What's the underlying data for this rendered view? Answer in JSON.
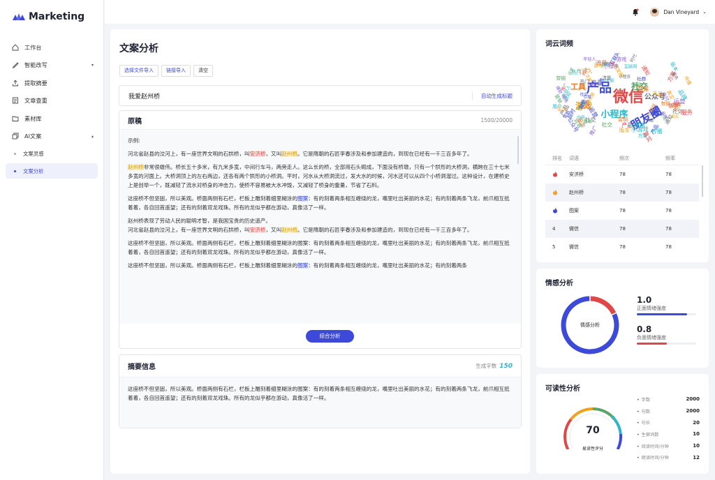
{
  "app": {
    "name": "Marketing"
  },
  "sidebar": {
    "items": [
      {
        "label": "工作台",
        "icon": "home-icon"
      },
      {
        "label": "智能改写",
        "icon": "pen-icon"
      },
      {
        "label": "提取摘要",
        "icon": "upload-icon"
      },
      {
        "label": "文章查重",
        "icon": "document-icon"
      },
      {
        "label": "素材库",
        "icon": "folder-icon"
      },
      {
        "label": "AI文案",
        "icon": "copy-icon"
      }
    ],
    "sub_items": [
      {
        "label": "文案灵感"
      },
      {
        "label": "文案分析",
        "active": true
      }
    ]
  },
  "header": {
    "user_name": "Dan Vineyard"
  },
  "main": {
    "title": "文案分析",
    "buttons": {
      "select_file": "选择文件导入",
      "link_import": "链接导入",
      "clear": "清空"
    },
    "article_title": "我爱赵州桥",
    "auto_title": "自动生成标题",
    "original": {
      "label": "原稿",
      "count": "1500/20000",
      "example_label": "示例:",
      "para1": {
        "a": "河北省赵县的洨河上，有一座世界文明的石拱桥，叫",
        "h1": "安济桥",
        "b": "，又叫",
        "h2": "赵州桥",
        "c": "。它是隋朝的石匠李春涉及和参加建造的，到现在已经有一千三百多年了。"
      },
      "para2": {
        "h": "赵州桥",
        "a": "非常很雄伟。桥长五十多米，有九米多宽，中间行车马，两旁走人。这么长的桥，全部用石头砌成，下面没有桥墩，只有一个拱形的大桥洞，横跨在三十七米多宽的河面上。大桥洞顶上的左右两边，还各有两个拱形的小桥洞。平时，河水从大桥洞流过，发大水的时候，河水还可以从四个小桥洞溜过。这种设计，在建桥史上是创举一个，既减轻了流水对桥身的冲击力，使桥不容易被大水冲毁，又减轻了桥身的重量，节省了石料。"
      },
      "para3": {
        "a": "这座桥不但坚固，所以美观。桥面两侧有石栏，栏板上雕刻着细里糊涂的",
        "h": "图案",
        "b": "：有的刻着两条相互缠绕的龙，嘴里吐出美丽的水花；有的刻着两条飞龙，前爪相互抵着着，各自回首遥望；还有的刻着双龙戏珠。所有的龙似乎都在游动，真像活了一样。"
      },
      "para4": {
        "line1": "赵州桥表现了劳动人民的聪明才智，是我国宝贵的历史遗产。",
        "a": "河北省赵县的洨河上，有一座世界文明的石拱桥，叫",
        "h1": "安济桥",
        "b": "，又叫",
        "h2": "赵州桥",
        "c": "。它是隋朝的石匠李春涉及和参加建造的，到现在已经有一千三百多年了。"
      },
      "para5": "这座桥不但坚固，所以美观。桥面两侧有石栏，栏板上雕刻着细里糊涂的图案：有的刻着两条相互缠绕的龙，嘴里吐出美丽的水花；有的刻着两条飞龙，前爪相互抵着着，各自回首遥望；还有的刻着双龙戏珠。所有的龙似乎都在游动，真像活了一样。",
      "para6": {
        "a": "这座桥不但坚固，所以美观。桥面两侧有石栏，栏板上雕刻着细里糊涂的",
        "h": "图案",
        "b": "：有的刻着两条相互缠绕的龙，嘴里吐出美丽的水花；有的刻着两条"
      },
      "analyze_button": "综合分析"
    },
    "summary": {
      "label": "摘要信息",
      "count_label": "生成字数",
      "count": "150",
      "text": "这座桥不但坚固，所以美观。桥面两侧有石栏，栏板上雕刻着细里糊涂的图案：有的刻着两条相互缠绕的龙，嘴里吐出美丽的水花；有的刻着两条飞龙，前爪相互抵着着，各自回首遥望；还有的刻着双龙戏珠。所有的龙似乎都在游动，真像活了一样。"
    }
  },
  "word_cloud": {
    "title": "词云词频",
    "words": [
      "产品",
      "微信",
      "朋友圈",
      "小程序",
      "游戏",
      "社交",
      "工具",
      "公众号",
      "原动力",
      "设计",
      "小游戏",
      "时代",
      "红利",
      "用户",
      "营销",
      "流量",
      "案例",
      "裂变",
      "创意",
      "真实",
      "版本",
      "互联网",
      "爆款",
      "引导",
      "数据",
      "传播",
      "超时",
      "生活",
      "服务",
      "方案",
      "内容",
      "社群",
      "年轻",
      "品牌",
      "运营",
      "支付",
      "手机",
      "直播",
      "在用",
      "年轻人",
      "热门",
      "推广",
      "新品",
      "通知"
    ],
    "colors": [
      "#3d49d8",
      "#e04848",
      "#f0a21f",
      "#2fb5c9",
      "#5aa469",
      "#8a63d2",
      "#e07a2f",
      "#6d6f7a"
    ],
    "columns": [
      "排名",
      "词语",
      "频次",
      "频率"
    ],
    "rows": [
      {
        "rank": "",
        "rank_icon": "flame-red-icon",
        "word": "安济桥",
        "freq": "78",
        "rate": "78"
      },
      {
        "rank": "",
        "rank_icon": "flame-orange-icon",
        "word": "赵州桥",
        "freq": "78",
        "rate": "78"
      },
      {
        "rank": "",
        "rank_icon": "flame-blue-icon",
        "word": "图案",
        "freq": "78",
        "rate": "78"
      },
      {
        "rank": "4",
        "word": "微信",
        "freq": "78",
        "rate": "78"
      },
      {
        "rank": "5",
        "word": "微信",
        "freq": "78",
        "rate": "78"
      }
    ]
  },
  "sentiment": {
    "title": "情感分析",
    "center_label": "情感分析",
    "positive": {
      "value": "1.0",
      "label": "正面情绪强度",
      "fraction": 0.85,
      "color": "#3d49d8"
    },
    "negative": {
      "value": "0.8",
      "label": "负面情绪强度",
      "fraction": 0.5,
      "color": "#e04848"
    },
    "positive_share": 0.82
  },
  "readability": {
    "title": "可读性分析",
    "score": "70",
    "score_label": "易读性评分",
    "score_fraction": 0.7,
    "stats": [
      {
        "label": "字数",
        "value": "2000"
      },
      {
        "label": "句数",
        "value": "2000"
      },
      {
        "label": "句长",
        "value": "20"
      },
      {
        "label": "生僻词数",
        "value": "10"
      },
      {
        "label": "阅读时间/分钟",
        "value": "10"
      },
      {
        "label": "朗读时间/分钟",
        "value": "12"
      }
    ]
  }
}
